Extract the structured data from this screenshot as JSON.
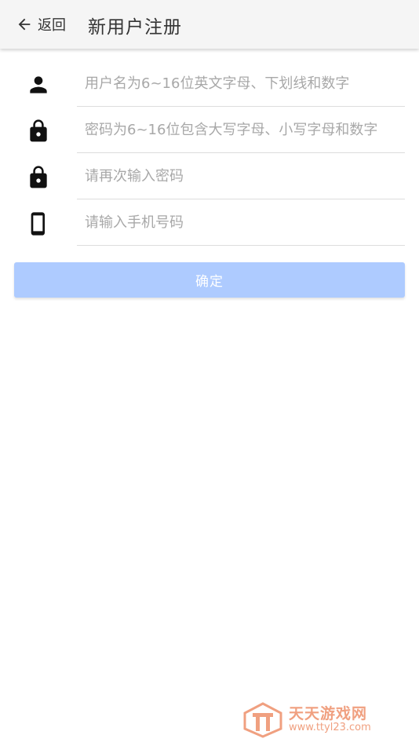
{
  "header": {
    "back_label": "返回",
    "title": "新用户注册"
  },
  "form": {
    "fields": [
      {
        "icon": "person-icon",
        "placeholder": "用户名为6~16位英文字母、下划线和数字",
        "value": ""
      },
      {
        "icon": "lock-icon",
        "placeholder": "密码为6~16位包含大写字母、小写字母和数字",
        "value": ""
      },
      {
        "icon": "lock-icon",
        "placeholder": "请再次输入密码",
        "value": ""
      },
      {
        "icon": "phone-icon",
        "placeholder": "请输入手机号码",
        "value": ""
      }
    ],
    "confirm_label": "确定"
  },
  "watermark": {
    "name": "天天游戏网",
    "url": "www.ttyl23.com"
  },
  "colors": {
    "topbar_bg": "#f5f5f5",
    "button_bg": "#aecbff",
    "watermark": "#f0a080"
  }
}
